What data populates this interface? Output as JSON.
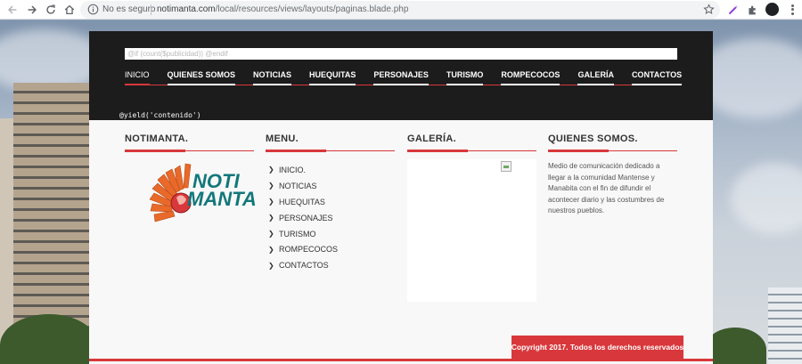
{
  "browser": {
    "security_label": "No es seguro",
    "url_host": "notimanta.com",
    "url_path": "/local/resources/views/layouts/paginas.blade.php"
  },
  "header": {
    "ad_placeholder": "@if (count($publicidad))  @endif",
    "nav": [
      {
        "label": "INICIO",
        "active": true
      },
      {
        "label": "QUIENES SOMOS"
      },
      {
        "label": "NOTICIAS"
      },
      {
        "label": "HUEQUITAS"
      },
      {
        "label": "PERSONAJES"
      },
      {
        "label": "TURISMO"
      },
      {
        "label": "ROMPECOCOS"
      },
      {
        "label": "GALERÍA"
      },
      {
        "label": "CONTACTOS"
      }
    ],
    "yield_text": "@yield('contenido')"
  },
  "footer": {
    "notimanta": {
      "title": "NOTIMANTA.",
      "logo_line1": "NOTI",
      "logo_line2": "MANTA"
    },
    "menu": {
      "title": "MENU.",
      "items": [
        "INICIO.",
        "NOTICIAS",
        "HUEQUITAS",
        "PERSONAJES",
        "TURISMO",
        "ROMPECOCOS",
        "CONTACTOS"
      ]
    },
    "galeria": {
      "title": "GALERÍA."
    },
    "quienes": {
      "title": "QUIENES SOMOS.",
      "text": "Medio de comunicación dedicado a llegar a la comunidad Mantense y Manabita con el fin de difundir el acontecer diario y las costumbres de nuestros pueblos."
    },
    "copyright": "Copyright 2017. Todos los derechos reservados"
  },
  "colors": {
    "accent": "#d8383c",
    "header_bg": "#1c1c1c",
    "logo_teal": "#12777a",
    "logo_orange": "#e8692a"
  }
}
